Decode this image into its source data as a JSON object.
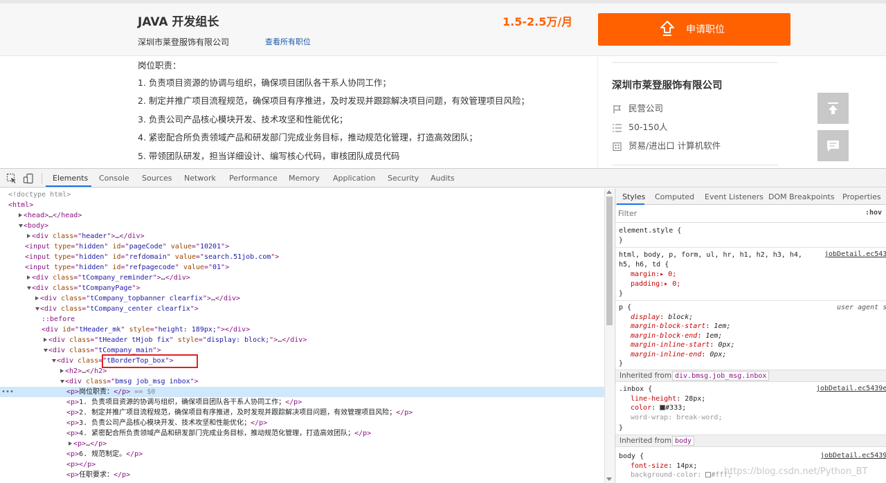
{
  "job": {
    "title": "JAVA 开发组长",
    "company": "深圳市莱登服饰有限公司",
    "all_jobs_link": "查看所有职位",
    "salary": "1.5-2.5万/月",
    "apply_label": "申请职位",
    "duties_heading": "岗位职责：",
    "duties": [
      "1. 负责项目资源的协调与组织，确保项目团队各干系人协同工作；",
      "2. 制定并推广项目流程规范，确保项目有序推进，及时发现并跟踪解决项目问题，有效管理项目风险；",
      "3. 负责公司产品核心模块开发、技术攻坚和性能优化；",
      "4. 紧密配合所负责领域产品和研发部门完成业务目标，推动规范化管理，打造高效团队；",
      "5.  带领团队研发，担当详细设计、编写核心代码，审核团队成员代码"
    ]
  },
  "company_box": {
    "name": "深圳市莱登服饰有限公司",
    "type": "民营公司",
    "size": "50-150人",
    "industry": "贸易/进出口  计算机软件"
  },
  "devtools": {
    "tabs": [
      "Elements",
      "Console",
      "Sources",
      "Network",
      "Performance",
      "Memory",
      "Application",
      "Security",
      "Audits"
    ],
    "active_tab": "Elements",
    "dom_lines": [
      {
        "indent": 0,
        "arrow": "",
        "html": "<span class='t-com'>&lt;!doctype html&gt;</span>"
      },
      {
        "indent": 0,
        "arrow": "",
        "html": "<span class='t-tag'>&lt;html&gt;</span>"
      },
      {
        "indent": 1,
        "arrow": "r",
        "html": "<span class='t-tag'>&lt;head&gt;</span>…<span class='t-tag'>&lt;/head&gt;</span>"
      },
      {
        "indent": 1,
        "arrow": "d",
        "html": "<span class='t-tag'>&lt;body&gt;</span>"
      },
      {
        "indent": 2,
        "arrow": "r",
        "html": "<span class='t-tag'>&lt;div </span><span class='t-attr'>class</span><span class='t-tag'>=\"</span><span class='t-val'>header</span><span class='t-tag'>\"&gt;</span>…<span class='t-tag'>&lt;/div&gt;</span>"
      },
      {
        "indent": 2,
        "arrow": "",
        "html": "<span class='t-tag'>&lt;input </span><span class='t-attr'>type</span><span class='t-tag'>=\"</span><span class='t-val'>hidden</span><span class='t-tag'>\" </span><span class='t-attr'>id</span><span class='t-tag'>=\"</span><span class='t-val'>pageCode</span><span class='t-tag'>\" </span><span class='t-attr'>value</span><span class='t-tag'>=\"</span><span class='t-val'>10201</span><span class='t-tag'>\"&gt;</span>"
      },
      {
        "indent": 2,
        "arrow": "",
        "html": "<span class='t-tag'>&lt;input </span><span class='t-attr'>type</span><span class='t-tag'>=\"</span><span class='t-val'>hidden</span><span class='t-tag'>\" </span><span class='t-attr'>id</span><span class='t-tag'>=\"</span><span class='t-val'>refdomain</span><span class='t-tag'>\" </span><span class='t-attr'>value</span><span class='t-tag'>=\"</span><span class='t-val'>search.51job.com</span><span class='t-tag'>\"&gt;</span>"
      },
      {
        "indent": 2,
        "arrow": "",
        "html": "<span class='t-tag'>&lt;input </span><span class='t-attr'>type</span><span class='t-tag'>=\"</span><span class='t-val'>hidden</span><span class='t-tag'>\" </span><span class='t-attr'>id</span><span class='t-tag'>=\"</span><span class='t-val'>refpagecode</span><span class='t-tag'>\" </span><span class='t-attr'>value</span><span class='t-tag'>=\"</span><span class='t-val'>01</span><span class='t-tag'>\"&gt;</span>"
      },
      {
        "indent": 2,
        "arrow": "r",
        "html": "<span class='t-tag'>&lt;div </span><span class='t-attr'>class</span><span class='t-tag'>=\"</span><span class='t-val'>tCompany_reminder</span><span class='t-tag'>\"&gt;</span>…<span class='t-tag'>&lt;/div&gt;</span>"
      },
      {
        "indent": 2,
        "arrow": "d",
        "html": "<span class='t-tag'>&lt;div </span><span class='t-attr'>class</span><span class='t-tag'>=\"</span><span class='t-val'>tCompanyPage</span><span class='t-tag'>\"&gt;</span>"
      },
      {
        "indent": 3,
        "arrow": "r",
        "html": "<span class='t-tag'>&lt;div </span><span class='t-attr'>class</span><span class='t-tag'>=\"</span><span class='t-val'>tCompany_topbanner clearfix</span><span class='t-tag'>\"&gt;</span>…<span class='t-tag'>&lt;/div&gt;</span>"
      },
      {
        "indent": 3,
        "arrow": "d",
        "html": "<span class='t-tag'>&lt;div </span><span class='t-attr'>class</span><span class='t-tag'>=\"</span><span class='t-val'>tCompany_center clearfix</span><span class='t-tag'>\"&gt;</span>"
      },
      {
        "indent": 4,
        "arrow": "",
        "html": "<span class='t-tag'>::before</span>"
      },
      {
        "indent": 4,
        "arrow": "",
        "html": "<span class='t-tag'>&lt;div </span><span class='t-attr'>id</span><span class='t-tag'>=\"</span><span class='t-val'>tHeader_mk</span><span class='t-tag'>\" </span><span class='t-attr'>style</span><span class='t-tag'>=\"</span><span class='t-val'>height: 189px;</span><span class='t-tag'>\"&gt;&lt;/div&gt;</span>"
      },
      {
        "indent": 4,
        "arrow": "r",
        "html": "<span class='t-tag'>&lt;div </span><span class='t-attr'>class</span><span class='t-tag'>=\"</span><span class='t-val'>tHeader tHjob fix</span><span class='t-tag'>\" </span><span class='t-attr'>style</span><span class='t-tag'>=\"</span><span class='t-val'>display: block;</span><span class='t-tag'>\"&gt;</span>…<span class='t-tag'>&lt;/div&gt;</span>"
      },
      {
        "indent": 4,
        "arrow": "d",
        "html": "<span class='t-tag'>&lt;div </span><span class='t-attr'>class</span><span class='t-tag'>=\"</span><span class='t-val'>tCompany_main</span><span class='t-tag'>\"&gt;</span>"
      },
      {
        "indent": 5,
        "arrow": "d",
        "html": "<span class='t-tag'>&lt;div </span><span class='t-attr'>class</span><span class='t-tag'>=\"</span><span class='t-val'>tBorderTop_box</span><span class='t-tag'>\"&gt;</span>"
      },
      {
        "indent": 6,
        "arrow": "r",
        "html": "<span class='t-tag'>&lt;h2&gt;</span>…<span class='t-tag'>&lt;/h2&gt;</span>"
      },
      {
        "indent": 6,
        "arrow": "d",
        "html": "<span class='t-tag'>&lt;div </span><span class='t-attr'>class</span><span class='t-tag'>=\"</span><span class='t-val'>bmsg job_msg inbox</span><span class='t-tag'>\"&gt;</span>"
      },
      {
        "indent": 7,
        "arrow": "",
        "sel": true,
        "html": "<span class='t-tag'>&lt;p&gt;</span><span class='t-text'>岗位职责：</span><span class='t-tag'>&lt;/p&gt;</span><span class='t-dim'> == $0</span>"
      },
      {
        "indent": 7,
        "arrow": "",
        "html": "<span class='t-tag'>&lt;p&gt;</span><span class='t-text'>1. 负责项目资源的协调与组织，确保项目团队各干系人协同工作；</span><span class='t-tag'>&lt;/p&gt;</span>"
      },
      {
        "indent": 7,
        "arrow": "",
        "html": "<span class='t-tag'>&lt;p&gt;</span><span class='t-text'>2. 制定并推广项目流程规范，确保项目有序推进，及时发现并跟踪解决项目问题，有效管理项目风险；</span><span class='t-tag'>&lt;/p&gt;</span>"
      },
      {
        "indent": 7,
        "arrow": "",
        "html": "<span class='t-tag'>&lt;p&gt;</span><span class='t-text'>3. 负责公司产品核心模块开发、技术攻坚和性能优化；</span><span class='t-tag'>&lt;/p&gt;</span>"
      },
      {
        "indent": 7,
        "arrow": "",
        "html": "<span class='t-tag'>&lt;p&gt;</span><span class='t-text'>4. 紧密配合所负责领域产品和研发部门完成业务目标，推动规范化管理，打造高效团队；</span><span class='t-tag'>&lt;/p&gt;</span>"
      },
      {
        "indent": 7,
        "arrow": "r",
        "html": "<span class='t-tag'>&lt;p&gt;</span>…<span class='t-tag'>&lt;/p&gt;</span>"
      },
      {
        "indent": 7,
        "arrow": "",
        "html": "<span class='t-tag'>&lt;p&gt;</span><span class='t-text'>6. 规范制定。</span><span class='t-tag'>&lt;/p&gt;</span>"
      },
      {
        "indent": 7,
        "arrow": "",
        "html": "<span class='t-tag'>&lt;p&gt;&lt;/p&gt;</span>"
      },
      {
        "indent": 7,
        "arrow": "",
        "html": "<span class='t-tag'>&lt;p&gt;</span><span class='t-text'>任职要求：</span><span class='t-tag'>&lt;/p&gt;</span>"
      }
    ],
    "styles_tabs": [
      "Styles",
      "Computed",
      "Event Listeners",
      "DOM Breakpoints",
      "Properties"
    ],
    "filter_placeholder": "Filter",
    "hov_label": ":hov",
    "element_style": "element.style {",
    "rule1_selector_a": "html, body, p, form, ul, hr, h1, h2, h3, h4,",
    "rule1_selector_b": "h5, h6, td {",
    "rule1_source": "jobDetail.ec543",
    "rule1_props": [
      "margin:▸ 0;",
      "padding:▸ 0;"
    ],
    "ua_selector": "p {",
    "ua_label": "user agent s",
    "ua_props": [
      [
        "display",
        "block;"
      ],
      [
        "margin-block-start",
        "1em;"
      ],
      [
        "margin-block-end",
        "1em;"
      ],
      [
        "margin-inline-start",
        "0px;"
      ],
      [
        "margin-inline-end",
        "0px;"
      ]
    ],
    "inherited_label": "Inherited from",
    "inherited_chip1": "div.bmsg.job_msg.inbox",
    "inbox_selector": ".inbox {",
    "inbox_source": "jobDetail.ec5439e",
    "inbox_props": [
      [
        "line-height",
        "28px;"
      ],
      [
        "color",
        "#333;"
      ],
      [
        "word-wrap",
        "break-word;"
      ]
    ],
    "inherited_chip2": "body",
    "body_selector": "body {",
    "body_source": "jobDetail.ec5439",
    "body_props": [
      [
        "font-size",
        "14px;"
      ],
      [
        "background-color",
        "#fff;"
      ]
    ],
    "close_brace": "}"
  },
  "watermark": "https://blog.csdn.net/Python_BT",
  "colors": {
    "accent": "#ff6000",
    "link": "#1c5aa8",
    "selection": "#cfe8fc",
    "annotation": "#e02020"
  }
}
